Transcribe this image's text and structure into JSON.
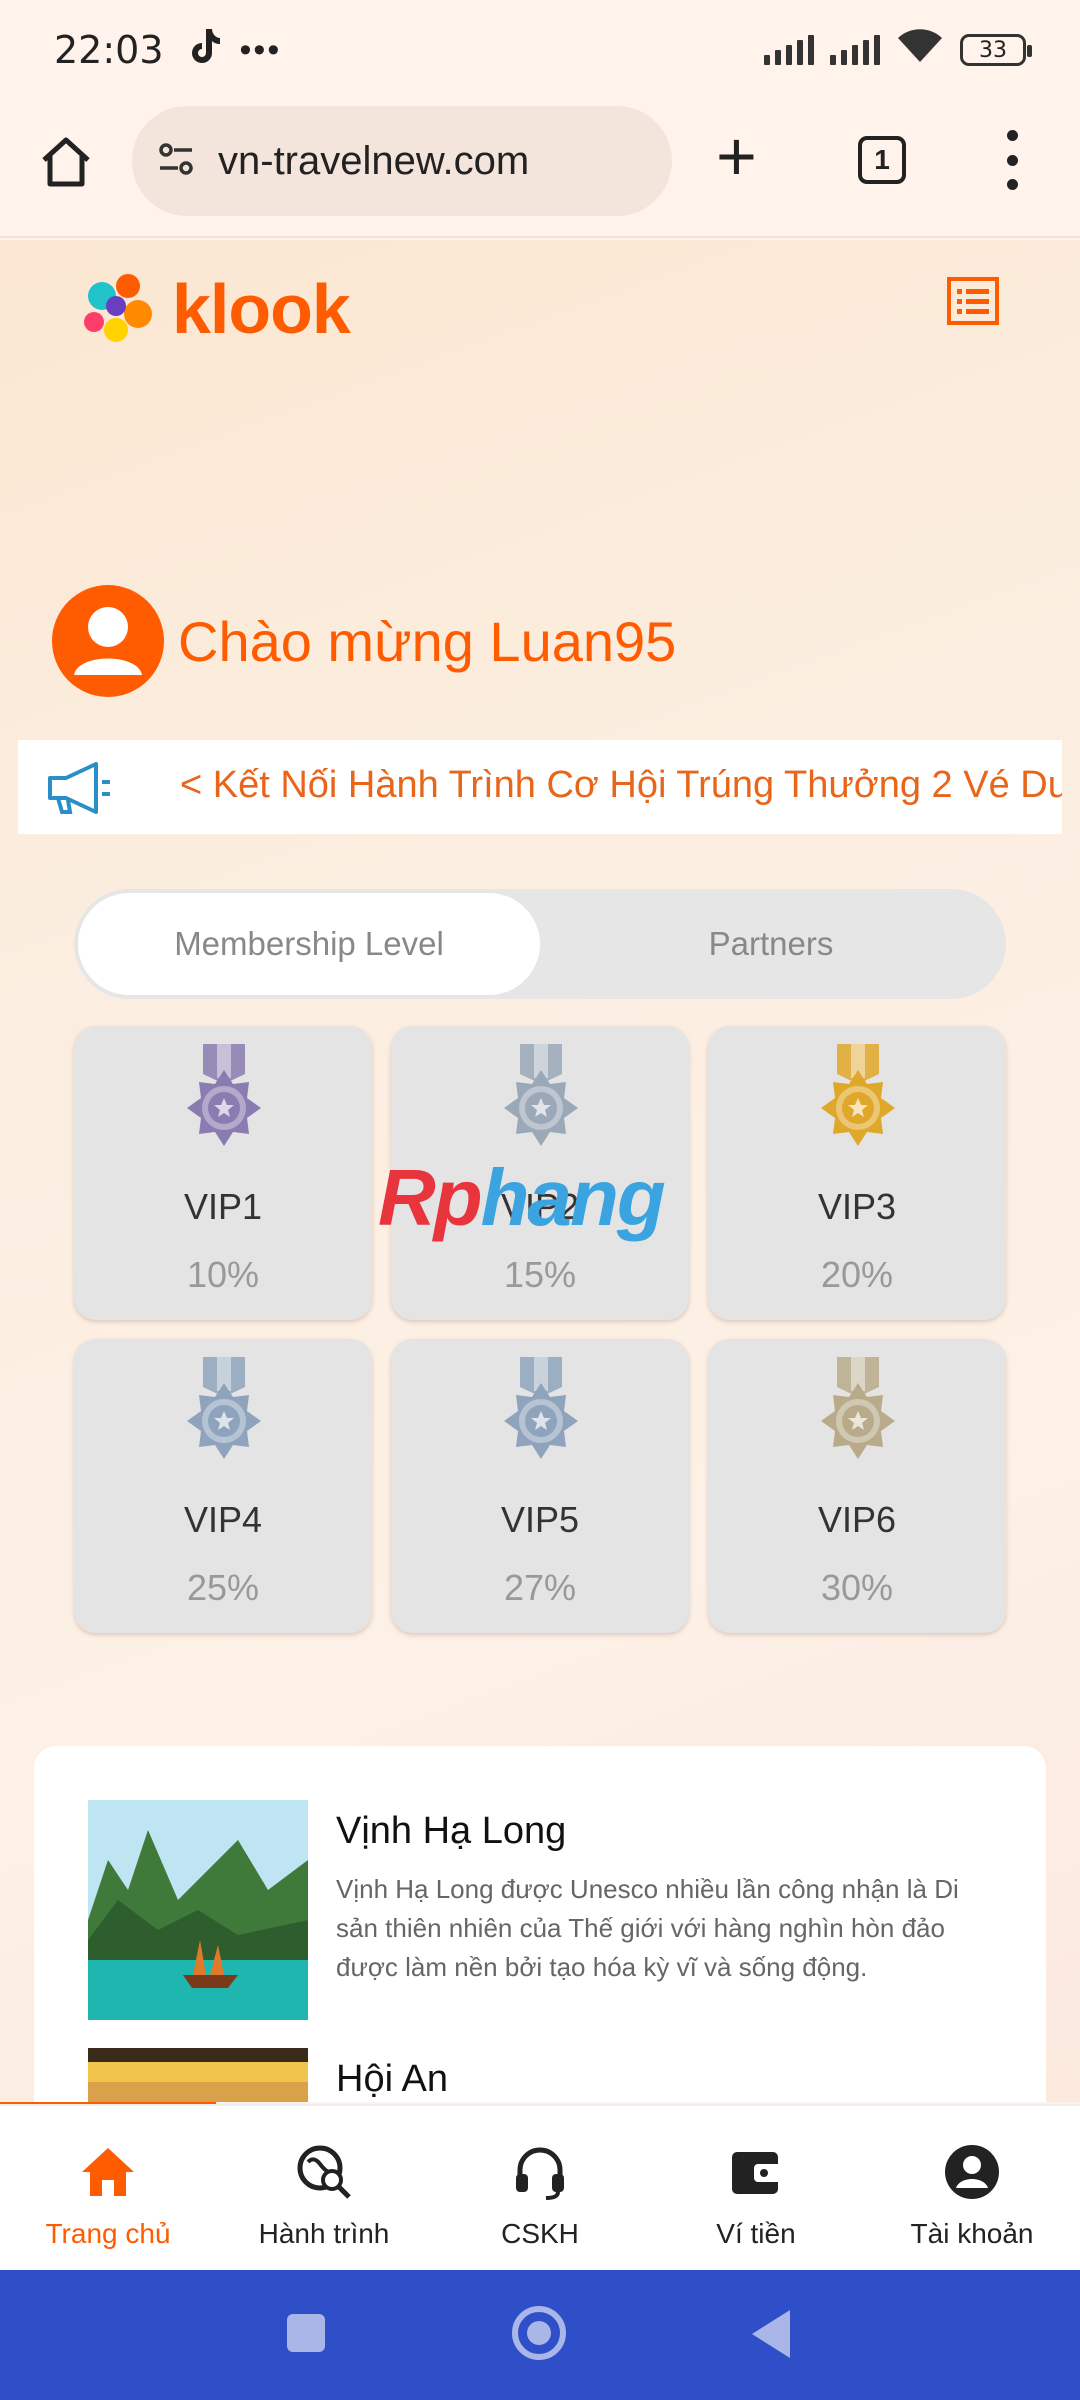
{
  "status_bar": {
    "time": "22:03",
    "dots": "•••",
    "battery": "33"
  },
  "browser": {
    "url": "vn-travelnew.com",
    "tab_count": "1"
  },
  "header": {
    "logo_text": "klook"
  },
  "welcome": {
    "text": "Chào mừng Luan95"
  },
  "announcement": {
    "text": "< Kết Nối Hành Trình Cơ Hội Trúng Thưởng 2 Vé Du"
  },
  "segment": {
    "active_label": "Membership Level",
    "inactive_label": "Partners"
  },
  "vip_levels": [
    {
      "name": "VIP1",
      "percent": "10%",
      "medal_color": "#8a7cb0"
    },
    {
      "name": "VIP2",
      "percent": "15%",
      "medal_color": "#9aa8b8"
    },
    {
      "name": "VIP3",
      "percent": "20%",
      "medal_color": "#e0a82a"
    },
    {
      "name": "VIP4",
      "percent": "25%",
      "medal_color": "#8fa4bc"
    },
    {
      "name": "VIP5",
      "percent": "27%",
      "medal_color": "#8fa4bc"
    },
    {
      "name": "VIP6",
      "percent": "30%",
      "medal_color": "#b9ab8a"
    }
  ],
  "watermark": {
    "part1": "Rp",
    "part2": "hang"
  },
  "destinations": [
    {
      "title": "Vịnh Hạ Long",
      "description": "Vịnh Hạ Long được Unesco nhiều lần công nhận là Di sản thiên nhiên của Thế giới với hàng nghìn hòn đảo được làm nền bởi tạo hóa kỳ vĩ và sống động."
    },
    {
      "title": "Hội An",
      "description": ""
    }
  ],
  "bottom_nav": [
    {
      "label": "Trang chủ",
      "icon": "home-icon"
    },
    {
      "label": "Hành trình",
      "icon": "journey-search-icon"
    },
    {
      "label": "CSKH",
      "icon": "headset-icon"
    },
    {
      "label": "Ví tiền",
      "icon": "wallet-icon"
    },
    {
      "label": "Tài khoản",
      "icon": "account-icon"
    }
  ],
  "colors": {
    "brand": "#ff5b00",
    "nav_bar": "#2e4fc7"
  }
}
